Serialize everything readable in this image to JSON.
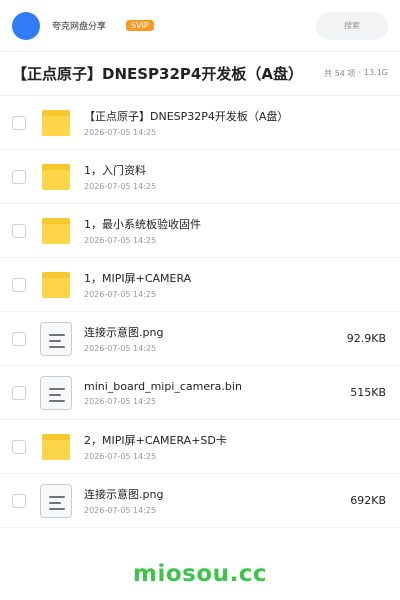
{
  "topbar": {
    "brand": "夸克网盘分享",
    "badge": "SVIP",
    "search_placeholder": "搜索"
  },
  "header": {
    "title": "【正点原子】DNESP32P4开发板（A盘）",
    "count": "共 54 项",
    "separator": "·",
    "total_size": "13.1G"
  },
  "files": [
    {
      "name": "【正点原子】DNESP32P4开发板（A盘）",
      "date": "2026-07-05 14:25",
      "type": "folder",
      "size": ""
    },
    {
      "name": "1，入门资料",
      "date": "2026-07-05 14:25",
      "type": "folder",
      "size": ""
    },
    {
      "name": "1，最小系统板验收固件",
      "date": "2026-07-05 14:25",
      "type": "folder",
      "size": ""
    },
    {
      "name": "1，MIPI屏+CAMERA",
      "date": "2026-07-05 14:25",
      "type": "folder",
      "size": ""
    },
    {
      "name": "连接示意图.png",
      "date": "2026-07-05 14:25",
      "type": "file",
      "size": "92.9KB"
    },
    {
      "name": "mini_board_mipi_camera.bin",
      "date": "2026-07-05 14:25",
      "type": "file",
      "size": "515KB"
    },
    {
      "name": "2，MIPI屏+CAMERA+SD卡",
      "date": "2026-07-05 14:25",
      "type": "folder",
      "size": ""
    },
    {
      "name": "连接示意图.png",
      "date": "2026-07-05 14:25",
      "type": "file",
      "size": "692KB"
    }
  ],
  "footer": {
    "watermark": "miosou.cc"
  },
  "colors": {
    "avatar": "#2f7cf6",
    "badge": "#f59a23",
    "folder": "#fcd54a",
    "watermark": "#3ec44a"
  },
  "icons": {
    "folder": "folder-icon",
    "file": "document-icon"
  }
}
